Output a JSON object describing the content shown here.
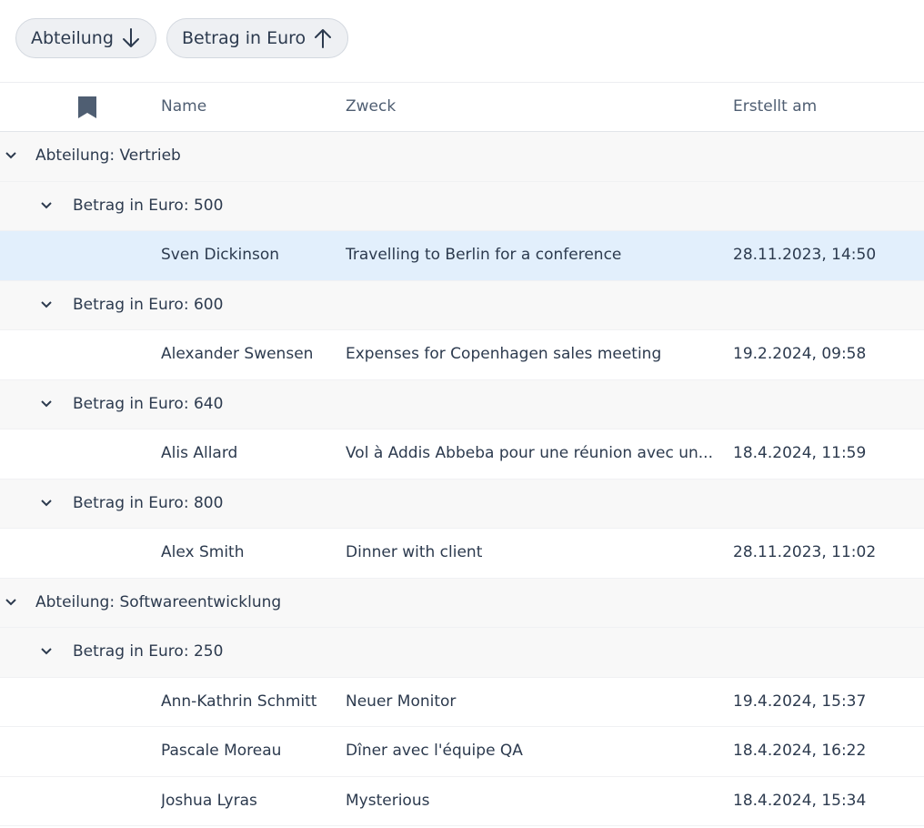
{
  "sort_chips": [
    {
      "label": "Abteilung",
      "direction": "descending"
    },
    {
      "label": "Betrag in Euro",
      "direction": "ascending"
    }
  ],
  "header": {
    "name": "Name",
    "purpose": "Zweck",
    "created": "Erstellt am"
  },
  "groups": {
    "vertrieb": "Abteilung: Vertrieb",
    "v500": "Betrag in Euro: 500",
    "v600": "Betrag in Euro: 600",
    "v640": "Betrag in Euro: 640",
    "v800": "Betrag in Euro: 800",
    "software": "Abteilung: Softwareentwicklung",
    "s250": "Betrag in Euro: 250"
  },
  "rows": [
    {
      "name": "Sven Dickinson",
      "purpose": "Travelling to Berlin for a conference",
      "created": "28.11.2023, 14:50"
    },
    {
      "name": "Alexander Swensen",
      "purpose": "Expenses for Copenhagen sales meeting",
      "created": "19.2.2024, 09:58"
    },
    {
      "name": "Alis Allard",
      "purpose": "Vol à Addis Abbeba pour une réunion avec un...",
      "created": "18.4.2024, 11:59"
    },
    {
      "name": "Alex Smith",
      "purpose": "Dinner with client",
      "created": "28.11.2023, 11:02"
    },
    {
      "name": "Ann-Kathrin Schmitt",
      "purpose": "Neuer Monitor",
      "created": "19.4.2024, 15:37"
    },
    {
      "name": "Pascale Moreau",
      "purpose": "Dîner avec l'équipe QA",
      "created": "18.4.2024, 16:22"
    },
    {
      "name": "Joshua Lyras",
      "purpose": "Mysterious",
      "created": "18.4.2024, 15:34"
    }
  ]
}
